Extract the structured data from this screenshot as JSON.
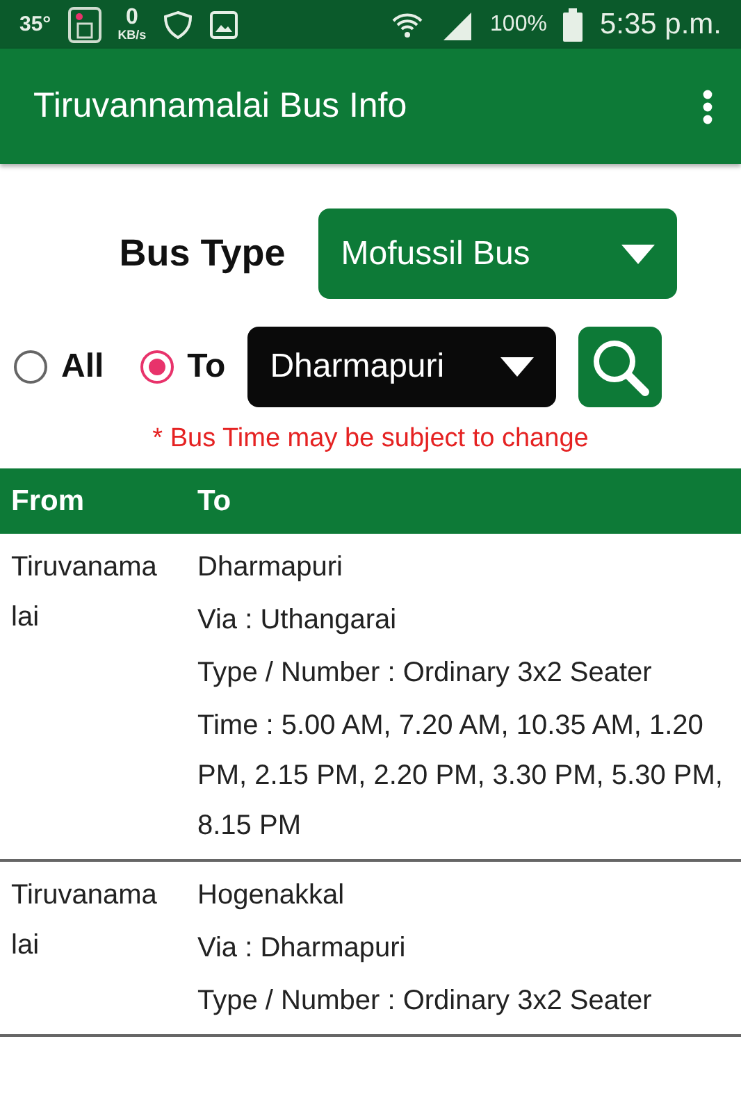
{
  "status_bar": {
    "temperature": "35°",
    "speed_value": "0",
    "speed_unit": "KB/s",
    "battery": "100%",
    "time": "5:35 p.m."
  },
  "app_bar": {
    "title": "Tiruvannamalai Bus Info"
  },
  "bus_type": {
    "label": "Bus Type",
    "value": "Mofussil Bus"
  },
  "filter": {
    "options": [
      {
        "label": "All",
        "selected": false
      },
      {
        "label": "To",
        "selected": true
      }
    ],
    "destination": "Dharmapuri"
  },
  "notice": "* Bus Time may be subject to change",
  "table": {
    "columns": [
      "From",
      "To"
    ],
    "rows": [
      {
        "from": "Tiruvanamalai",
        "to": "Dharmapuri",
        "via": "Via : Uthangarai",
        "type": "Type / Number :  Ordinary 3x2 Seater",
        "time": "Time : 5.00 AM,  7.20 AM,  10.35 AM,  1.20 PM,  2.15 PM,  2.20 PM,  3.30 PM,  5.30 PM,  8.15 PM"
      },
      {
        "from": "Tiruvanamalai",
        "to": "Hogenakkal",
        "via": "Via : Dharmapuri",
        "type": "Type / Number :  Ordinary 3x2 Seater"
      }
    ]
  }
}
